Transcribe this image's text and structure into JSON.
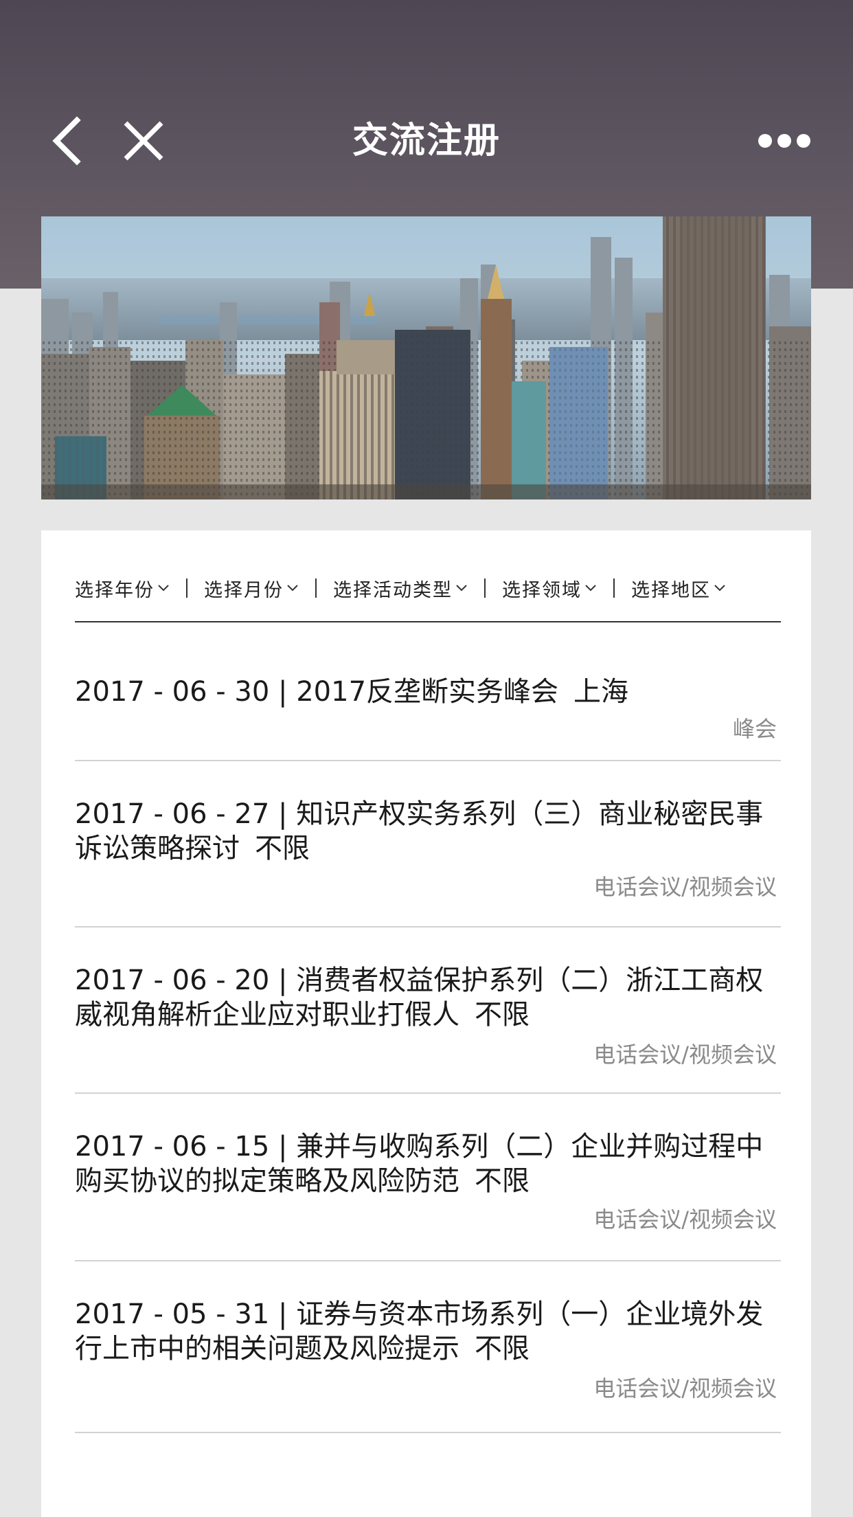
{
  "nav": {
    "title": "交流注册"
  },
  "filters": [
    {
      "label": "选择年份"
    },
    {
      "label": "选择月份"
    },
    {
      "label": "选择活动类型"
    },
    {
      "label": "选择领域"
    },
    {
      "label": "选择地区"
    }
  ],
  "events": [
    {
      "date": "2017 - 06 - 30",
      "title": "2017反垄断实务峰会",
      "location": "上海",
      "type": "峰会"
    },
    {
      "date": "2017 - 06 - 27",
      "title": "知识产权实务系列（三）商业秘密民事诉讼策略探讨",
      "location": "不限",
      "type": "电话会议/视频会议"
    },
    {
      "date": "2017 - 06 - 20",
      "title": "消费者权益保护系列（二）浙江工商权威视角解析企业应对职业打假人",
      "location": "不限",
      "type": "电话会议/视频会议"
    },
    {
      "date": "2017 - 06 - 15",
      "title": "兼并与收购系列（二）企业并购过程中购买协议的拟定策略及风险防范",
      "location": "不限",
      "type": "电话会议/视频会议"
    },
    {
      "date": "2017 - 05 - 31",
      "title": "证券与资本市场系列（一）企业境外发行上市中的相关问题及风险提示",
      "location": "不限",
      "type": "电话会议/视频会议"
    }
  ]
}
